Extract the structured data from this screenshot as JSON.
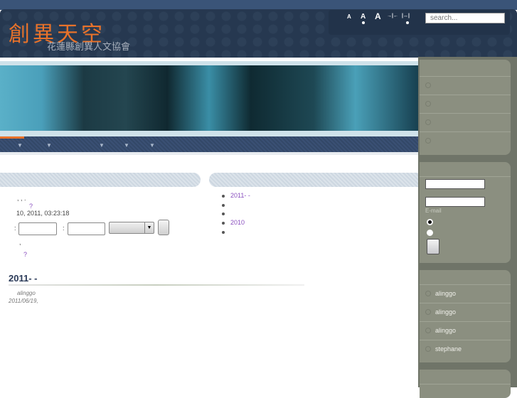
{
  "header": {
    "logo": "創異天空",
    "subtitle": "花蓮縣創異人文協會",
    "search_placeholder": "search...",
    "tools": [
      {
        "label": "A",
        "name": "font-small"
      },
      {
        "label": "A",
        "name": "font-medium"
      },
      {
        "label": "A",
        "name": "font-large"
      },
      {
        "label": "→|←",
        "name": "width-narrow"
      },
      {
        "label": "|↔|",
        "name": "width-wide"
      }
    ]
  },
  "left": {
    "line1": ",   ,          .",
    "q1": "?",
    "date": "10, 2011, 03:23:18",
    "colon1": ":",
    "colon2": ":",
    "comma": ",",
    "q2": "?",
    "post": {
      "title": "2011-            -",
      "author": "alinggo",
      "date": "2011/06/19,"
    }
  },
  "archive": [
    "2011-      -",
    "",
    "",
    "2010",
    ""
  ],
  "sidebar": {
    "email_label": "E-mail",
    "users": [
      "alinggo",
      "alinggo",
      "alinggo",
      "stephane"
    ]
  },
  "colors": {
    "accent": "#e8722a",
    "header": "#263850",
    "sidebar": "#8b8f80",
    "link": "#8a4fbf"
  }
}
